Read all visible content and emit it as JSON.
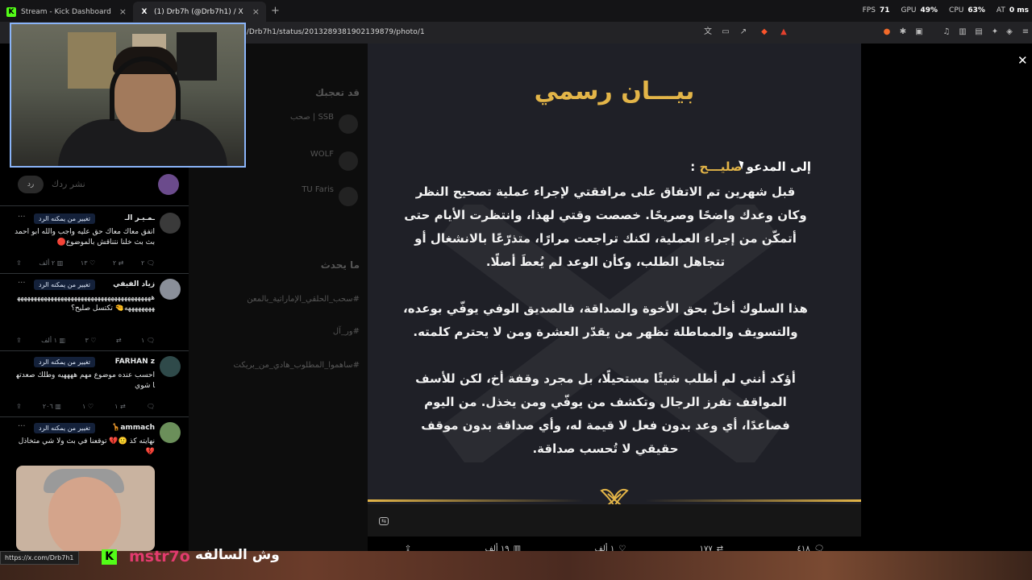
{
  "browser": {
    "tabs": [
      {
        "title": "Stream - Kick Dashboard",
        "active": false,
        "icon": "kick-icon"
      },
      {
        "title": "(1) Drb7h (@Drb7h1) / X",
        "active": true,
        "icon": "x-icon"
      }
    ],
    "url": "n/Drb7h1/status/2013289381902139879/photo/1",
    "new_tab": "+",
    "stats": {
      "fps_label": "FPS",
      "fps": "71",
      "gpu_label": "GPU",
      "gpu": "49%",
      "cpu_label": "CPU",
      "cpu": "63%",
      "bat_label": "AT",
      "bat": "0 ms"
    }
  },
  "replies": {
    "button": "رد",
    "placeholder": "نشر ردك",
    "items": [
      {
        "name": "ـمـيـر الـ",
        "tag": "تغيير من يمكنه الرد",
        "text": "اتفق معاك معاك حق عليه واجب والله ابو احمد بث بث خلنا نتناقش بالموضوع🔴",
        "replies": "٢",
        "reposts": "٢",
        "likes": "١٣",
        "views": "٢ ألف",
        "avatar_color": "#3a3a3a"
      },
      {
        "name": "زياد الفيفي",
        "tag": "تغيير من يمكنه الرد",
        "text": "هههههههههههههههههههههههههههههههههههههههههههههههههه🤏 تكتسل صليح؟",
        "replies": "١",
        "reposts": "",
        "likes": "٣",
        "views": "١ ألف",
        "avatar_color": "#8a8f99"
      },
      {
        "name": "FARHAN z",
        "tag": "تغيير من يمكنه الرد",
        "text": "احسب عنده موضوع مهم ههههيه وطلك صعدتها شوي",
        "replies": "",
        "reposts": "١",
        "likes": "١",
        "views": "٢٠٦",
        "avatar_color": "#2f4a4a"
      },
      {
        "name": "ammach🦒",
        "tag": "تغيير من يمكنه الرد",
        "text": "نهايته كذ 🙂💔 توقعنا في بث ولا شي متخاذل💔",
        "replies": "",
        "reposts": "",
        "likes": "",
        "views": "",
        "avatar_color": "#6b8f5a"
      }
    ]
  },
  "timeline_behind": [
    "قد تعجبك",
    "SSB | صحب",
    "WOLF",
    "TU Faris",
    "ما يحدث",
    "#سحب_الحلقي_الإماراتية_بالمعن",
    "#ور_آل",
    "#ساهموا_المطلوب_هادي_من_بريكت"
  ],
  "statement": {
    "title": "بيـــان رسمي",
    "to_prefix": "إلى المدعو",
    "to_name": "صليـــح",
    "to_suffix": ":",
    "para1": "قبل شهرين تم الاتفاق على مرافقتي لإجراء عملية تصحيح النظر وكان وعدك واضحًا وصريحًا. خصصت وقتي لهذا، وانتظرت الأيام حتى أتمكّن من إجراء العملية، لكنك تراجعت مرارًا، متذرّعًا بالانشغال أو تتجاهل الطلب، وكأن الوعد لم يُعطَ أصلًا.",
    "para2": "هذا السلوك أخلّ بحق الأخوة والصداقة، فالصديق الوفي يوفّي بوعده، والتسويف والمماطلة تظهر من يقدّر العشرة ومن لا يحترم كلمته.",
    "para3": "أؤكد أنني لم أطلب شيئًا مستحيلًا، بل مجرد وقفة أخ، لكن للأسف المواقف تفرز الرجال وتكشف من يوفّي ومن يخذل. من اليوم فصاعدًا، أي وعد بدون فعل لا قيمة له، وأي صداقة بدون موقف حقيقي لا تُحسب صداقة."
  },
  "post_actions": {
    "replies": "٤١٨",
    "reposts": "١٧٧",
    "likes": "١ ألف",
    "views": "١٩ ألف"
  },
  "overlay": {
    "status_url": "https://x.com/Drb7h1",
    "kick_logo": "K",
    "username": "mstr7o",
    "message": "وش السالفه"
  },
  "colors": {
    "gold": "#e3b548",
    "kick": "#53fc18",
    "username": "#e23b6e",
    "accent": "#8ab4f8"
  }
}
